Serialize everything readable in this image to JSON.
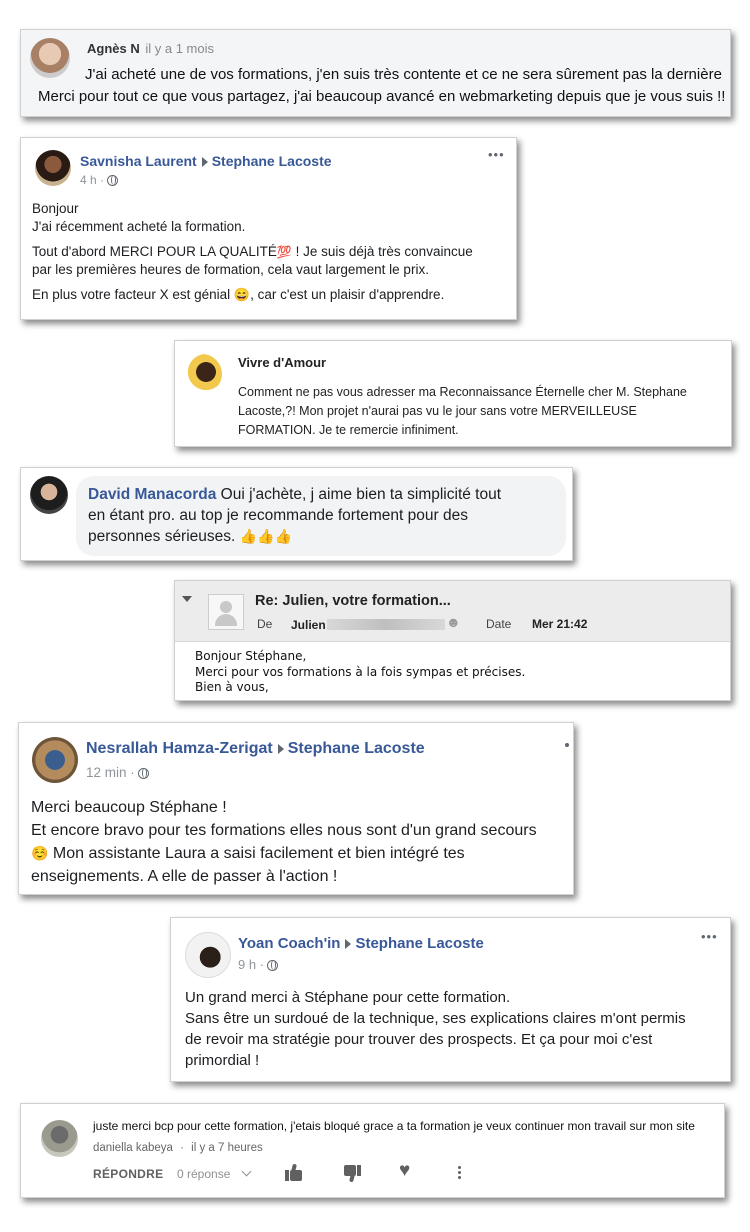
{
  "c1": {
    "author": "Agnès N",
    "time": "il y a 1 mois",
    "line1": "J'ai acheté une de vos formations, j'en suis très contente et ce ne sera sûrement pas la dernière",
    "line2": "Merci pour tout ce que vous partagez, j'ai beaucoup avancé en webmarketing depuis que je vous suis !!"
  },
  "c2": {
    "author": "Savnisha Laurent",
    "target": "Stephane Lacoste",
    "time": "4 h ·",
    "menu": "•••",
    "l1": "Bonjour",
    "l2": "J'ai récemment acheté la formation.",
    "l3": "Tout d'abord MERCI POUR LA QUALITÉ",
    "emoji100": "💯",
    "l3b": " ! Je suis déjà très convaincue",
    "l4": "par les premières heures de formation, cela vaut largement le prix.",
    "l5": "En plus votre facteur X est génial ",
    "emojiSmile": "😄",
    "l5b": ", car c'est un plaisir d'apprendre."
  },
  "c3": {
    "author": "Vivre d'Amour",
    "l1": "Comment ne pas vous adresser ma Reconnaissance Éternelle cher M. Stephane",
    "l2": "Lacoste,?! Mon projet n'aurai pas vu le jour sans votre MERVEILLEUSE",
    "l3": "FORMATION. Je te remercie infiniment."
  },
  "c4": {
    "author": "David Manacorda",
    "l1": " Oui j'achète, j aime bien ta simplicité tout",
    "l2": "en étant pro. au top je recommande fortement pour des",
    "l3": "personnes sérieuses. ",
    "thumbs": "👍👍👍"
  },
  "c5": {
    "subject": "Re: Julien, votre formation...",
    "from_label": "De",
    "from_name": "Julien",
    "date_label": "Date",
    "date_value": "Mer 21:42",
    "b1": "Bonjour Stéphane,",
    "b2": "Merci pour vos formations à la fois sympas et précises.",
    "b3": "Bien à vous,"
  },
  "c6": {
    "author": "Nesrallah Hamza-Zerigat",
    "target": "Stephane Lacoste",
    "time": "12 min ·",
    "l1": "Merci beaucoup Stéphane !",
    "l2": "Et encore bravo pour tes formations elles nous sont d'un grand secours",
    "emoji": "☺️",
    "l3": " Mon assistante Laura a saisi facilement et bien intégré tes",
    "l4": "enseignements. A elle de passer à l'action !"
  },
  "c7": {
    "author": "Yoan Coach'in",
    "target": "Stephane Lacoste",
    "time": "9 h ·",
    "menu": "•••",
    "l1": "Un grand merci à Stéphane pour cette formation.",
    "l2": "Sans être un surdoué de la technique, ses explications claires m'ont permis",
    "l3": "de revoir ma stratégie pour trouver des prospects. Et ça pour moi c'est",
    "l4": "primordial !"
  },
  "c8": {
    "text": "juste merci bcp pour cette formation, j'etais bloqué grace a ta formation je veux continuer mon travail sur mon site",
    "author": "daniella kabeya",
    "time": "il y a 7 heures",
    "reply": "RÉPONDRE",
    "replies": "0 réponse"
  }
}
